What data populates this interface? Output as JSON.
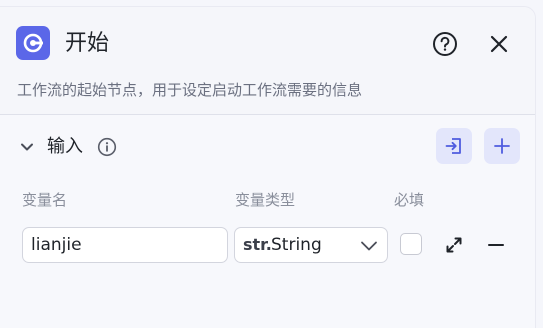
{
  "header": {
    "title": "开始",
    "description": "工作流的起始节点，用于设定启动工作流需要的信息",
    "logo_icon": "start-node-icon",
    "help_icon": "question-circle-icon",
    "close_icon": "close-icon"
  },
  "inputs_section": {
    "title": "输入",
    "expanded": true,
    "info_icon": "info-circle-icon",
    "import_icon": "import-icon",
    "add_icon": "plus-icon",
    "columns": {
      "name": "变量名",
      "type": "变量类型",
      "required": "必填"
    },
    "rows": [
      {
        "name": "lianjie",
        "type_prefix": "str.",
        "type": "String",
        "required": false
      }
    ]
  },
  "colors": {
    "accent": "#5b67e8",
    "accent_soft": "#e3e6fb",
    "background": "#f7f8fc"
  }
}
